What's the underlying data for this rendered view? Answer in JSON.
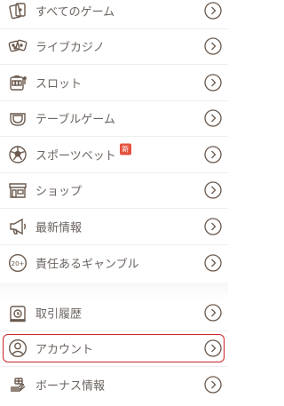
{
  "menu": {
    "items": [
      {
        "label": "すべてのゲーム",
        "icon": "cards-icon"
      },
      {
        "label": "ライブカジノ",
        "icon": "dice-icon"
      },
      {
        "label": "スロット",
        "icon": "slot-machine-icon"
      },
      {
        "label": "テーブルゲーム",
        "icon": "table-game-icon"
      },
      {
        "label": "スポーツベット",
        "icon": "soccer-ball-icon",
        "badge": "新"
      },
      {
        "label": "ショップ",
        "icon": "shop-icon"
      },
      {
        "label": "最新情報",
        "icon": "megaphone-icon"
      },
      {
        "label": "責任あるギャンブル",
        "icon": "age-20-plus-icon",
        "icon_text": "20+"
      },
      {
        "label": "取引履歴",
        "icon": "transaction-history-icon"
      },
      {
        "label": "アカウント",
        "icon": "account-icon",
        "selected": true
      },
      {
        "label": "ボーナス情報",
        "icon": "bonus-gift-icon"
      }
    ]
  },
  "colors": {
    "text": "#6b6460",
    "icon": "#6b5a4e",
    "highlight_border": "#c9262c",
    "badge": "#e5533f"
  }
}
